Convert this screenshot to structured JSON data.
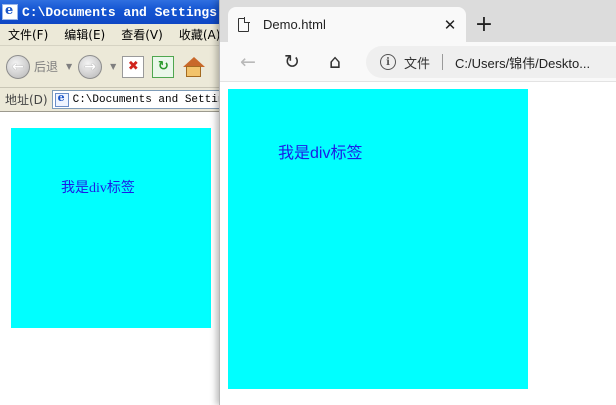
{
  "ie_window": {
    "title": "C:\\Documents and Settings",
    "menu": [
      "文件(F)",
      "编辑(E)",
      "查看(V)",
      "收藏(A)"
    ],
    "toolbar": {
      "back_label": "后退"
    },
    "address_label": "地址(D)",
    "address_value": "C:\\Documents and Settings",
    "div_text": "我是div标签",
    "div_color": "#00ffff"
  },
  "edge_window": {
    "tab_title": "Demo.html",
    "file_label": "文件",
    "url": "C:/Users/锦伟/Deskto...",
    "div_text": "我是div标签",
    "div_color": "#00ffff"
  },
  "colors": {
    "div_text": "#1c1ce6",
    "titlebar": "#1556d3"
  }
}
